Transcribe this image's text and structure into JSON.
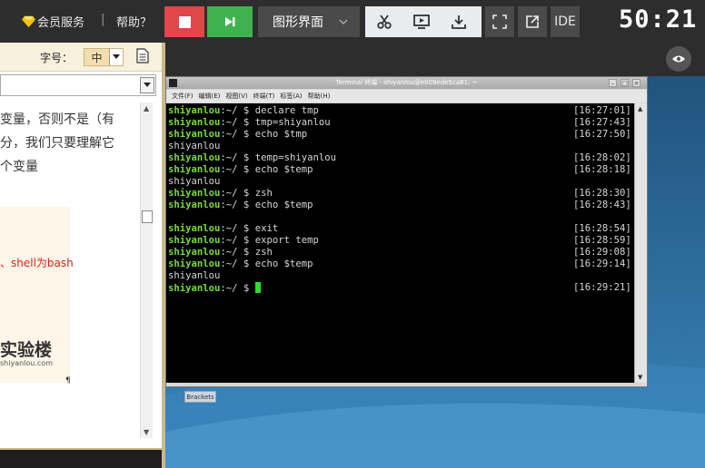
{
  "topbar": {
    "vip_label": "会员服务",
    "separator": "|",
    "help_label": "帮助？",
    "mode_label": "图形界面",
    "ide_label": "IDE",
    "timer": "50:21"
  },
  "left_panel": {
    "font_size_label": "字号：",
    "font_size_value": "中",
    "doc_lines": [
      "变量，否则不是（有",
      "分，我们只要理解它",
      "个变量"
    ],
    "image_red_text": "、shell为bash",
    "image_logo_text": "实验楼",
    "image_logo_url": "shiyanlou.com",
    "mark": "¶"
  },
  "terminal": {
    "title": "Terminal 终端 - shiyanlou@eb09ede5ca81: ~",
    "menu": [
      "文件(F)",
      "编辑(E)",
      "视图(V)",
      "终端(T)",
      "标签(A)",
      "帮助(H)"
    ],
    "prompt_host": "shiyanlou",
    "prompt_suffix": ":~/ $ ",
    "lines": [
      {
        "type": "cmd",
        "text": "declare tmp",
        "time": "[16:27:01]"
      },
      {
        "type": "cmd",
        "text": "tmp=shiyanlou",
        "time": "[16:27:43]"
      },
      {
        "type": "cmd",
        "text": "echo $tmp",
        "time": "[16:27:50]"
      },
      {
        "type": "out",
        "text": "shiyanlou",
        "time": ""
      },
      {
        "type": "cmd",
        "text": "temp=shiyanlou",
        "time": "[16:28:02]"
      },
      {
        "type": "cmd",
        "text": "echo $temp",
        "time": "[16:28:18]"
      },
      {
        "type": "out",
        "text": "shiyanlou",
        "time": ""
      },
      {
        "type": "cmd",
        "text": "zsh",
        "time": "[16:28:30]"
      },
      {
        "type": "cmd",
        "text": "echo $temp",
        "time": "[16:28:43]"
      },
      {
        "type": "out",
        "text": "",
        "time": ""
      },
      {
        "type": "cmd",
        "text": "exit",
        "time": "[16:28:54]"
      },
      {
        "type": "cmd",
        "text": "export temp",
        "time": "[16:28:59]"
      },
      {
        "type": "cmd",
        "text": "zsh",
        "time": "[16:29:08]"
      },
      {
        "type": "cmd",
        "text": "echo $temp",
        "time": "[16:29:14]"
      },
      {
        "type": "out",
        "text": "shiyanlou",
        "time": ""
      },
      {
        "type": "cursor",
        "text": "",
        "time": "[16:29:21]"
      }
    ]
  },
  "desktop": {
    "brackets_label": "Brackets"
  },
  "colors": {
    "stop": "#e0464a",
    "next": "#3fb24f",
    "prompt": "#7bdc3a",
    "cursor": "#2de02d",
    "gem": "#f4c20d"
  }
}
